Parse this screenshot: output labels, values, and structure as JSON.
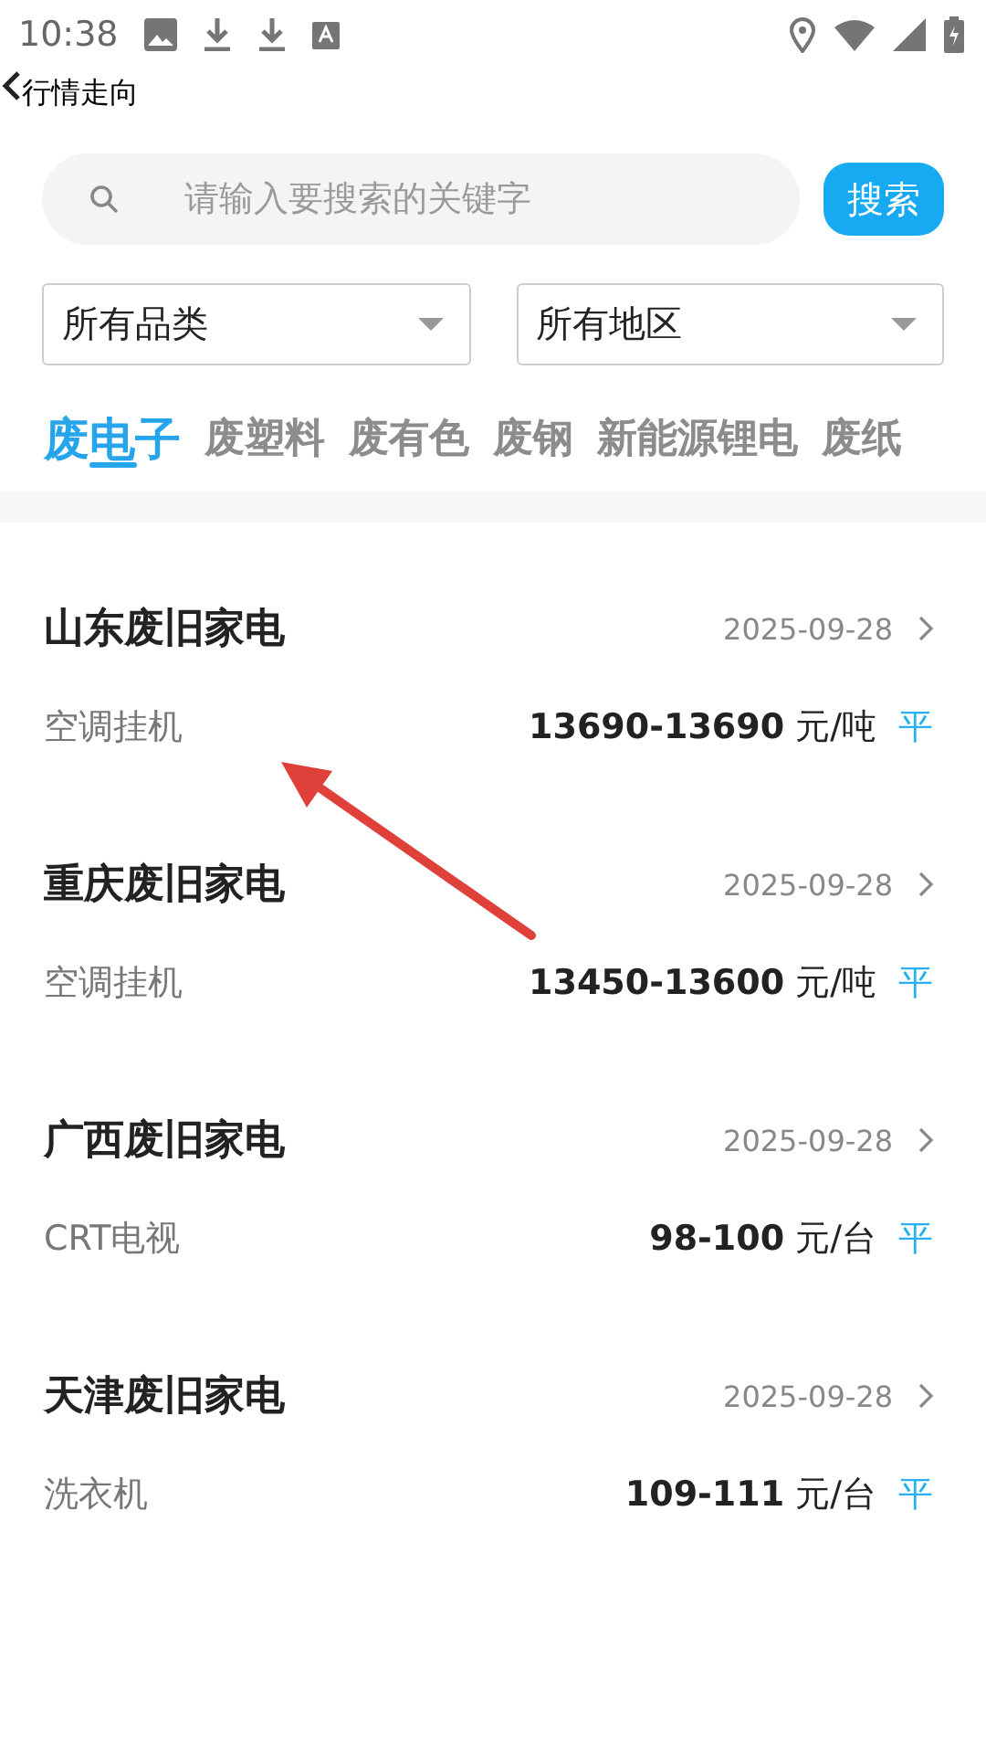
{
  "status_bar": {
    "time": "10:38"
  },
  "header": {
    "title": "行情走向"
  },
  "search": {
    "placeholder": "请输入要搜索的关键字",
    "button": "搜索"
  },
  "filters": [
    {
      "label": "所有品类"
    },
    {
      "label": "所有地区"
    }
  ],
  "tabs": [
    {
      "label": "废电子",
      "selected": true
    },
    {
      "label": "废塑料",
      "selected": false
    },
    {
      "label": "废有色",
      "selected": false
    },
    {
      "label": "废钢",
      "selected": false
    },
    {
      "label": "新能源锂电",
      "selected": false
    },
    {
      "label": "废纸",
      "selected": false
    }
  ],
  "items": [
    {
      "title": "山东废旧家电",
      "date": "2025-09-28",
      "product": "空调挂机",
      "price": "13690-13690",
      "unit": "元/吨",
      "trend": "平"
    },
    {
      "title": "重庆废旧家电",
      "date": "2025-09-28",
      "product": "空调挂机",
      "price": "13450-13600",
      "unit": "元/吨",
      "trend": "平"
    },
    {
      "title": "广西废旧家电",
      "date": "2025-09-28",
      "product": "CRT电视",
      "price": "98-100",
      "unit": "元/台",
      "trend": "平"
    },
    {
      "title": "天津废旧家电",
      "date": "2025-09-28",
      "product": "洗衣机",
      "price": "109-111",
      "unit": "元/台",
      "trend": "平"
    }
  ]
}
